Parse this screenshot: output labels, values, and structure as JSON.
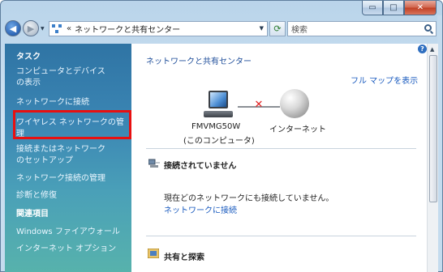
{
  "window": {
    "minimize_glyph": "▭",
    "maximize_glyph": "□",
    "close_glyph": "✕"
  },
  "address_bar": {
    "chevron": "«",
    "path": "ネットワークと共有センター",
    "dropdown_glyph": "▼"
  },
  "search": {
    "placeholder": "検索"
  },
  "sidebar": {
    "tasks_heading": "タスク",
    "items": [
      "コンピュータとデバイスの表示",
      "ネットワークに接続",
      "ワイヤレス ネットワークの管理",
      "接続またはネットワークのセットアップ",
      "ネットワーク接続の管理",
      "診断と修復"
    ],
    "related_heading": "関連項目",
    "related_items": [
      "Windows ファイアウォール",
      "インターネット オプション"
    ],
    "highlight_color": "#e81010"
  },
  "main": {
    "title": "ネットワークと共有センター",
    "full_map_link": "フル マップを表示",
    "computer_name": "FMVMG50W",
    "computer_caption": "(このコンピュータ)",
    "internet_label": "インターネット",
    "status_x": "✕",
    "not_connected_heading": "接続されていません",
    "not_connected_message": "現在どのネットワークにも接続していません。",
    "connect_link": "ネットワークに接続",
    "sharing_heading": "共有と探索"
  },
  "colors": {
    "link": "#1a5bbf",
    "title": "#1f4e9a",
    "sidebar_top": "#2f74a4",
    "sidebar_bottom": "#57b2ac"
  }
}
